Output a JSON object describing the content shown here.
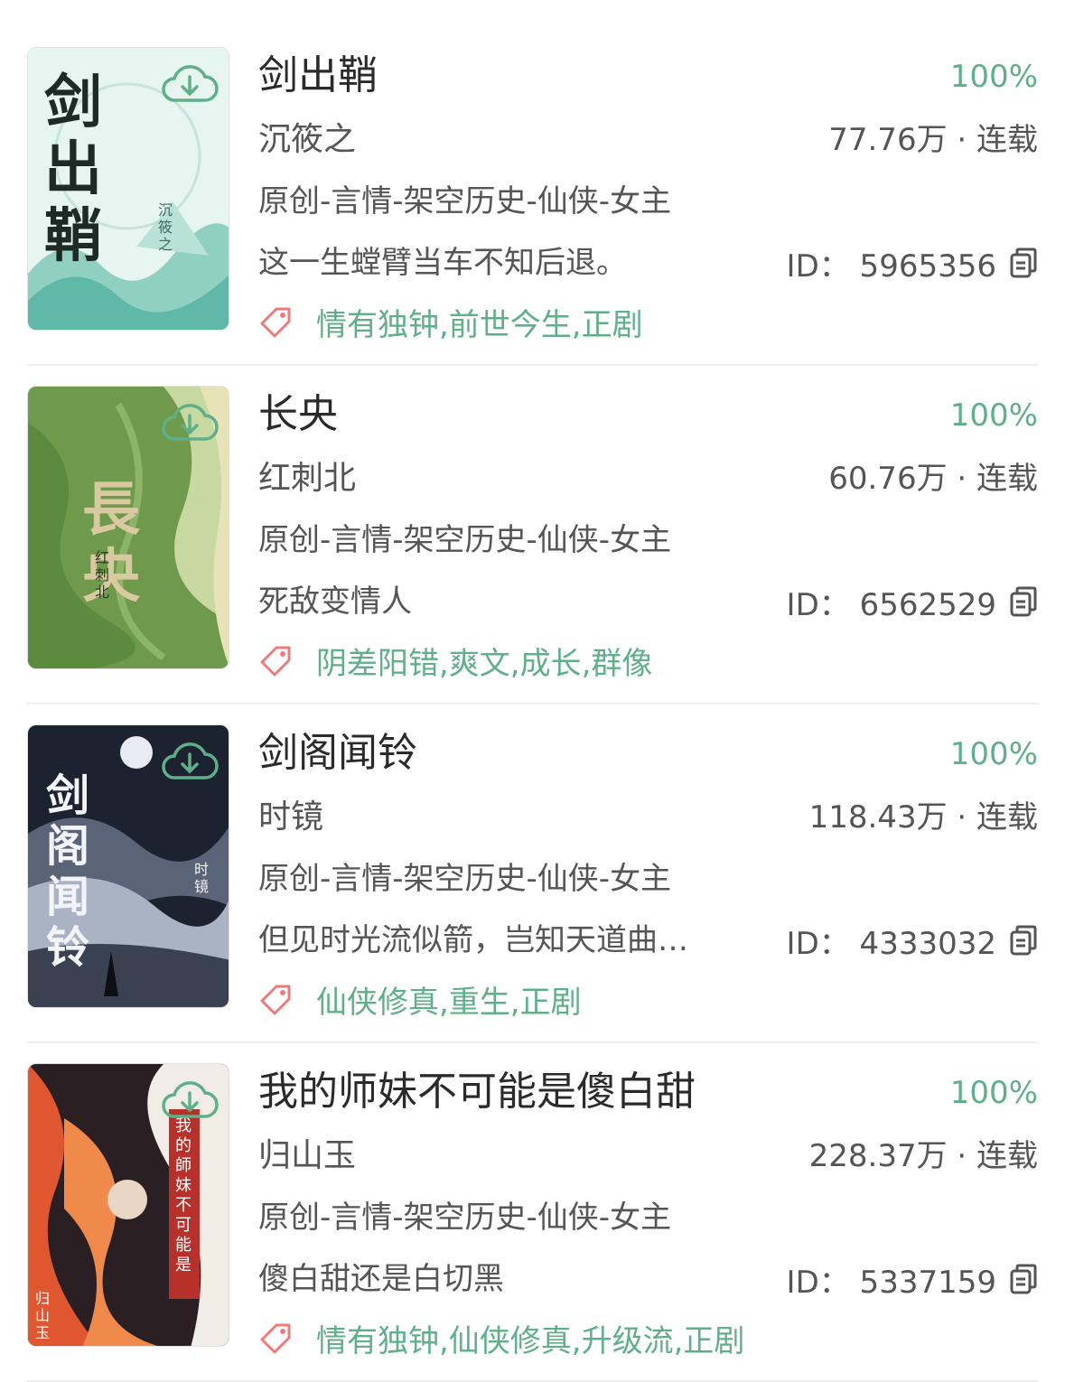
{
  "colors": {
    "accent": "#5fb08a",
    "tag_icon": "#f07a7a",
    "text": "#555555"
  },
  "icons": {
    "download": "cloud-download-icon",
    "copy": "copy-icon",
    "tag": "tag-icon"
  },
  "books": [
    {
      "cover_title": "剑出鞘",
      "cover_author": "沉筱之",
      "title": "剑出鞘",
      "progress": "100%",
      "author": "沉筱之",
      "words_status": "77.76万 · 连载",
      "category": "原创-言情-架空历史-仙侠-女主",
      "blurb": "这一生螳臂当车不知后退。",
      "id_text": "ID：  5965356",
      "tags": "情有独钟,前世今生,正剧"
    },
    {
      "cover_title": "長央",
      "cover_author": "红刺北",
      "title": "长央",
      "progress": "100%",
      "author": "红刺北",
      "words_status": "60.76万 · 连载",
      "category": "原创-言情-架空历史-仙侠-女主",
      "blurb": "死敌变情人",
      "id_text": "ID：  6562529",
      "tags": "阴差阳错,爽文,成长,群像"
    },
    {
      "cover_title": "剑阁闻铃",
      "cover_author": "时镜",
      "title": "剑阁闻铃",
      "progress": "100%",
      "author": "时镜",
      "words_status": "118.43万 · 连载",
      "category": "原创-言情-架空历史-仙侠-女主",
      "blurb": "但见时光流似箭，岂知天道曲…",
      "id_text": "ID：  4333032",
      "tags": "仙侠修真,重生,正剧"
    },
    {
      "cover_title": "我的師妹不可能是",
      "cover_author": "归山玉",
      "title": "我的师妹不可能是傻白甜",
      "progress": "100%",
      "author": "归山玉",
      "words_status": "228.37万 · 连载",
      "category": "原创-言情-架空历史-仙侠-女主",
      "blurb": "傻白甜还是白切黑",
      "id_text": "ID：  5337159",
      "tags": "情有独钟,仙侠修真,升级流,正剧"
    }
  ]
}
